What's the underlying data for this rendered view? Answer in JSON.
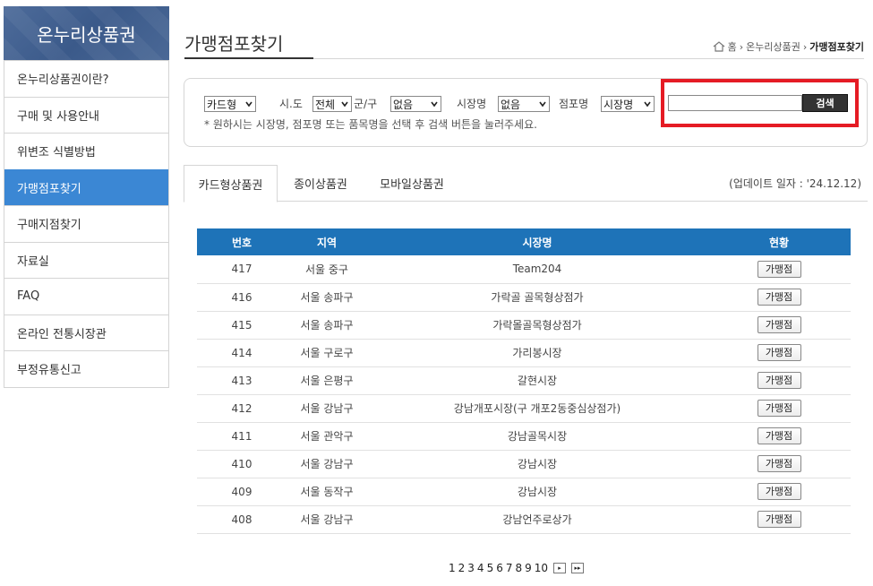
{
  "sidebar": {
    "brand": "온누리상품권",
    "items": [
      {
        "label": "온누리상품권이란?"
      },
      {
        "label": "구매 및 사용안내"
      },
      {
        "label": "위변조 식별방법"
      },
      {
        "label": "가맹점포찾기"
      },
      {
        "label": "구매지점찾기"
      },
      {
        "label": "자료실"
      },
      {
        "label": "FAQ"
      },
      {
        "label": "온라인 전통시장관"
      },
      {
        "label": "부정유통신고"
      }
    ]
  },
  "header": {
    "title": "가맹점포찾기",
    "breadcrumb": {
      "home": "홈",
      "parent": "온누리상품권",
      "current": "가맹점포찾기"
    }
  },
  "search": {
    "card_type": "카드형",
    "sido_label": "시.도",
    "sido_value": "전체",
    "gungu_label": "군/구",
    "gungu_value": "없음",
    "market_label": "시장명",
    "market_value": "없음",
    "store_label": "점포명",
    "store_type_value": "시장명",
    "keyword_value": "",
    "button_label": "검색",
    "hint": "* 원하시는 시장명, 점포명 또는 품목명을 선택 후 검색 버튼을 눌러주세요."
  },
  "tabs": [
    {
      "label": "카드형상품권"
    },
    {
      "label": "종이상품권"
    },
    {
      "label": "모바일상품권"
    }
  ],
  "update_text": "(업데이트 일자 : '24.12.12)",
  "table": {
    "headers": [
      "번호",
      "지역",
      "시장명",
      "현황"
    ],
    "rows": [
      {
        "no": "417",
        "region": "서울 중구",
        "market": "Team204",
        "status": "가맹점"
      },
      {
        "no": "416",
        "region": "서울 송파구",
        "market": "가락골 골목형상점가",
        "status": "가맹점"
      },
      {
        "no": "415",
        "region": "서울 송파구",
        "market": "가락몰골목형상점가",
        "status": "가맹점"
      },
      {
        "no": "414",
        "region": "서울 구로구",
        "market": "가리봉시장",
        "status": "가맹점"
      },
      {
        "no": "413",
        "region": "서울 은평구",
        "market": "갈현시장",
        "status": "가맹점"
      },
      {
        "no": "412",
        "region": "서울 강남구",
        "market": "강남개포시장(구 개포2동중심상점가)",
        "status": "가맹점"
      },
      {
        "no": "411",
        "region": "서울 관악구",
        "market": "강남골목시장",
        "status": "가맹점"
      },
      {
        "no": "410",
        "region": "서울 강남구",
        "market": "강남시장",
        "status": "가맹점"
      },
      {
        "no": "409",
        "region": "서울 동작구",
        "market": "강남시장",
        "status": "가맹점"
      },
      {
        "no": "408",
        "region": "서울 강남구",
        "market": "강남언주로상가",
        "status": "가맹점"
      }
    ]
  },
  "pagination": {
    "pages": [
      "1",
      "2",
      "3",
      "4",
      "5",
      "6",
      "7",
      "8",
      "9",
      "10"
    ],
    "next_icon": "next-arrow",
    "last_icon": "last-double-arrow"
  },
  "colors": {
    "brand_bg": "#3b5a8a",
    "active_menu": "#3b87d4",
    "table_header": "#1e73b8",
    "highlight": "#e51b24"
  }
}
